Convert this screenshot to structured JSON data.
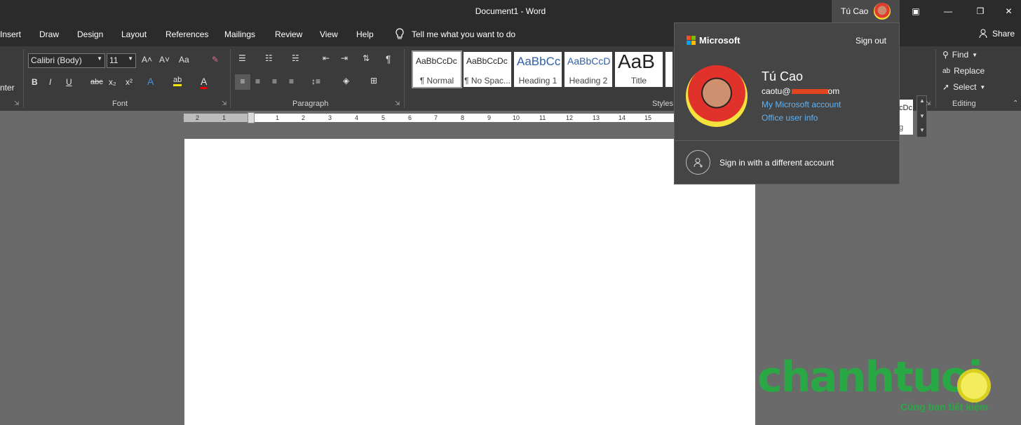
{
  "title_bar": {
    "document_title": "Document1  -  Word",
    "user_name": "Tú Cao",
    "restore_label": "□",
    "minimize_label": "—",
    "maximize_label": "❐",
    "close_label": "✕",
    "ribbon_display_label": "▣"
  },
  "tabs": [
    "Insert",
    "Draw",
    "Design",
    "Layout",
    "References",
    "Mailings",
    "Review",
    "View",
    "Help"
  ],
  "tell_me": "Tell me what you want to do",
  "share": "Share",
  "ribbon": {
    "clipboard_partial": "nter",
    "font": {
      "name": "Calibri (Body)",
      "size": "11",
      "group_label": "Font",
      "bold": "B",
      "italic": "I",
      "underline": "U",
      "strike": "abc",
      "subscript": "x₂",
      "superscript": "x²",
      "grow": "A˄",
      "shrink": "A˅",
      "case": "Aa"
    },
    "paragraph": {
      "group_label": "Paragraph",
      "pilcrow": "¶"
    },
    "styles": {
      "group_label": "Styles",
      "items": [
        {
          "preview": "AaBbCcDc",
          "label": "¶ Normal"
        },
        {
          "preview": "AaBbCcDc",
          "label": "¶ No Spac..."
        },
        {
          "preview": "AaBbCc",
          "label": "Heading 1"
        },
        {
          "preview": "AaBbCcD",
          "label": "Heading 2"
        },
        {
          "preview": "AaB",
          "label": "Title"
        }
      ],
      "partial_right_preview": "cDc",
      "partial_right_label": "g"
    },
    "editing": {
      "group_label": "Editing",
      "find": "Find",
      "replace": "Replace",
      "select": "Select"
    }
  },
  "ruler_numbers": [
    "2",
    "1",
    "1",
    "2",
    "3",
    "4",
    "5",
    "6",
    "7",
    "8",
    "9",
    "10",
    "11",
    "12",
    "13",
    "14",
    "15"
  ],
  "account_flyout": {
    "brand": "Microsoft",
    "sign_out": "Sign out",
    "display_name": "Tú Cao",
    "email_visible": "caotu@",
    "email_suffix": "om",
    "my_account_link": "My Microsoft account",
    "user_info_link": "Office user info",
    "sign_in_different": "Sign in with a different account"
  },
  "watermark": {
    "brand": "chanhtuoi",
    "tagline": "Cùng bạn tiết kiệm"
  }
}
